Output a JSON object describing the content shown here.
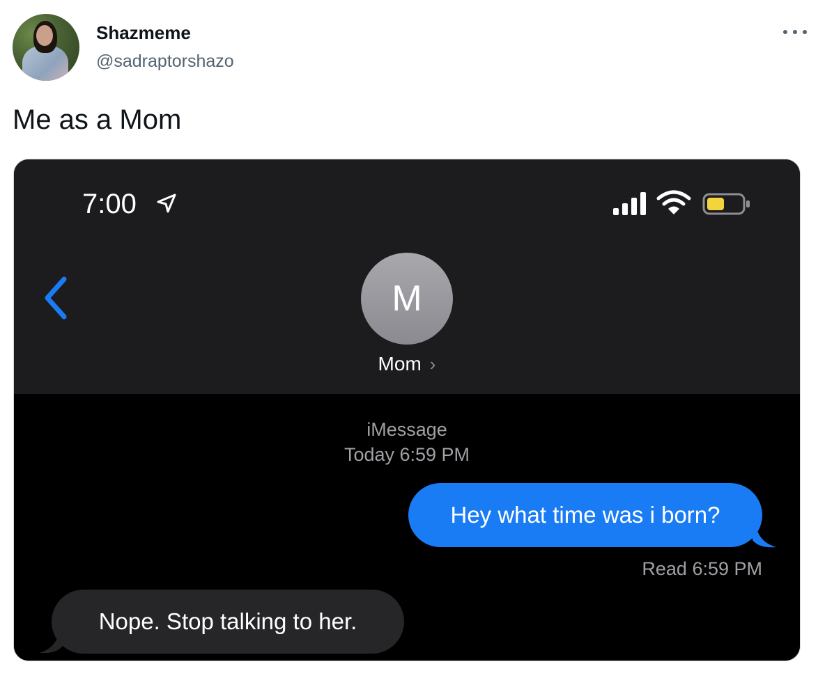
{
  "tweet": {
    "display_name": "Shazmeme",
    "handle": "@sadraptorshazo",
    "text": "Me as a Mom"
  },
  "screenshot": {
    "status_bar": {
      "time": "7:00",
      "battery_color": "#f2d53c"
    },
    "contact": {
      "initial": "M",
      "name": "Mom"
    },
    "thread": {
      "service": "iMessage",
      "timestamp": "Today 6:59 PM",
      "messages": [
        {
          "direction": "outgoing",
          "text": "Hey what time was i born?",
          "color": "#1a7cf5"
        },
        {
          "direction": "incoming",
          "text": "Nope. Stop talking to her.",
          "color": "#262629"
        }
      ],
      "read_receipt": "Read 6:59 PM"
    }
  },
  "colors": {
    "accent_blue": "#1a7cf5",
    "chevron_blue": "#1a7cf5"
  }
}
